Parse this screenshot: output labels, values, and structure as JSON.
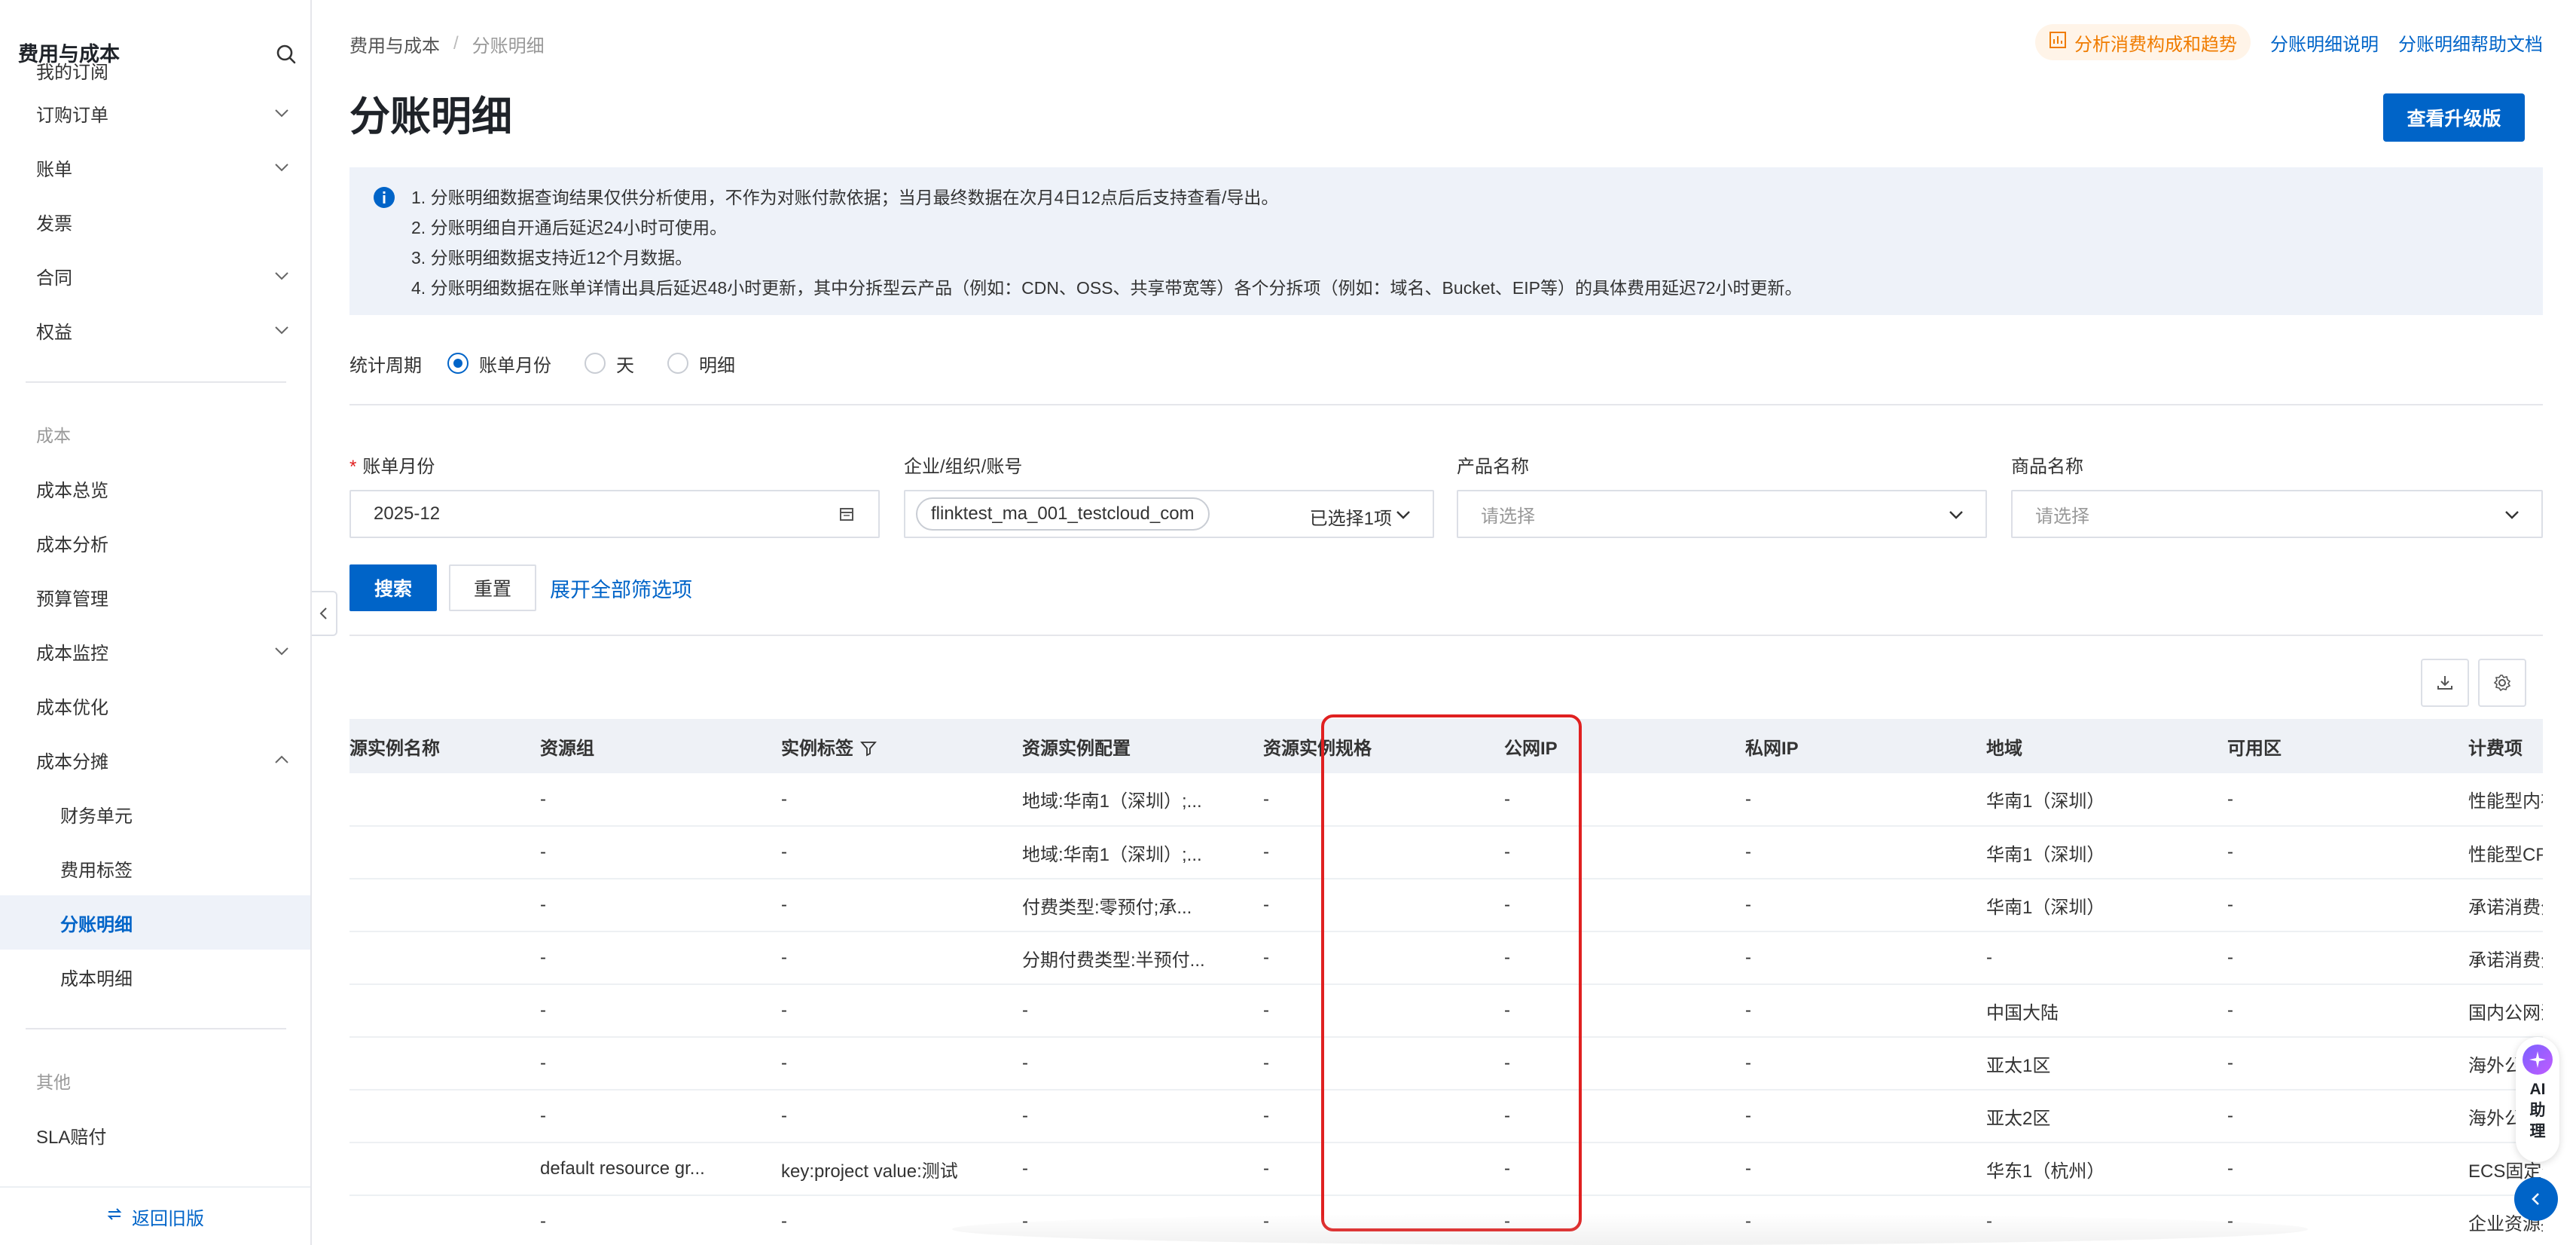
{
  "sidebar": {
    "title": "费用与成本",
    "items": [
      {
        "label": "我的订阅",
        "chevron": false
      },
      {
        "label": "订购订单",
        "chevron": "down"
      },
      {
        "label": "账单",
        "chevron": "down"
      },
      {
        "label": "发票",
        "chevron": false
      },
      {
        "label": "合同",
        "chevron": "down"
      },
      {
        "label": "权益",
        "chevron": "down"
      }
    ],
    "group_cost": "成本",
    "cost_items": [
      {
        "label": "成本总览"
      },
      {
        "label": "成本分析"
      },
      {
        "label": "预算管理"
      },
      {
        "label": "成本监控"
      },
      {
        "label": "成本优化"
      },
      {
        "label": "成本分摊"
      }
    ],
    "sub_items": [
      {
        "label": "财务单元"
      },
      {
        "label": "费用标签"
      },
      {
        "label": "分账明细"
      },
      {
        "label": "成本明细"
      }
    ],
    "group_other": "其他",
    "other_items": [
      {
        "label": "SLA赔付"
      }
    ],
    "footer": "返回旧版"
  },
  "breadcrumb": {
    "root": "费用与成本",
    "separator": "/",
    "current": "分账明细"
  },
  "top_links": {
    "analyze": "分析消费构成和趋势",
    "explain": "分账明细说明",
    "help": "分账明细帮助文档"
  },
  "page_title": "分账明细",
  "upgrade_button": "查看升级版",
  "notice": [
    "1. 分账明细数据查询结果仅供分析使用，不作为对账付款依据；当月最终数据在次月4日12点后后支持查看/导出。",
    "2. 分账明细自开通后延迟24小时可使用。",
    "3. 分账明细数据支持近12个月数据。",
    "4. 分账明细数据在账单详情出具后延迟48小时更新，其中分拆型云产品（例如：CDN、OSS、共享带宽等）各个分拆项（例如：域名、Bucket、EIP等）的具体费用延迟72小时更新。"
  ],
  "period": {
    "label": "统计周期",
    "options": [
      "账单月份",
      "天",
      "明细"
    ],
    "selected": "账单月份"
  },
  "filters": {
    "month": {
      "label": "账单月份",
      "value": "2025-12"
    },
    "account": {
      "label": "企业/组织/账号",
      "value": "flinktest_ma_001_testcloud_com",
      "count": "已选择1项"
    },
    "product": {
      "label": "产品名称",
      "placeholder": "请选择"
    },
    "commodity": {
      "label": "商品名称",
      "placeholder": "请选择"
    }
  },
  "actions": {
    "search": "搜索",
    "reset": "重置",
    "expand": "展开全部筛选项"
  },
  "table": {
    "columns": [
      "资源实例名称",
      "资源组",
      "实例标签",
      "资源实例配置",
      "资源实例规格",
      "公网IP",
      "私网IP",
      "地域",
      "可用区",
      "计费项"
    ],
    "column_first_visible": "源实例名称",
    "rows": [
      [
        "",
        "-",
        "-",
        "地域:华南1（深圳）;...",
        "-",
        "-",
        "-",
        "华南1（深圳）",
        "-",
        "性能型内存"
      ],
      [
        "",
        "-",
        "-",
        "地域:华南1（深圳）;...",
        "-",
        "-",
        "-",
        "华南1（深圳）",
        "-",
        "性能型CPU"
      ],
      [
        "",
        "-",
        "-",
        "付费类型:零预付;承...",
        "-",
        "-",
        "-",
        "华南1（深圳）",
        "-",
        "承诺消费分"
      ],
      [
        "",
        "-",
        "-",
        "分期付费类型:半预付...",
        "-",
        "-",
        "-",
        "-",
        "-",
        "承诺消费分"
      ],
      [
        "",
        "-",
        "-",
        "-",
        "-",
        "-",
        "-",
        "中国大陆",
        "-",
        "国内公网流"
      ],
      [
        "",
        "-",
        "-",
        "-",
        "-",
        "-",
        "-",
        "亚太1区",
        "-",
        "海外公网"
      ],
      [
        "",
        "-",
        "-",
        "-",
        "-",
        "-",
        "-",
        "亚太2区",
        "-",
        "海外公网"
      ],
      [
        "",
        "default resource gr...",
        "key:project value:测试",
        "-",
        "-",
        "-",
        "-",
        "华东1（杭州）",
        "-",
        "ECS固定分"
      ],
      [
        "",
        "-",
        "-",
        "-",
        "-",
        "-",
        "-",
        "-",
        "-",
        "企业资源报"
      ]
    ]
  },
  "ai_widget": "AI助理",
  "colors": {
    "primary": "#0064c8",
    "highlight": "#e02020",
    "orange": "#f07c00"
  }
}
